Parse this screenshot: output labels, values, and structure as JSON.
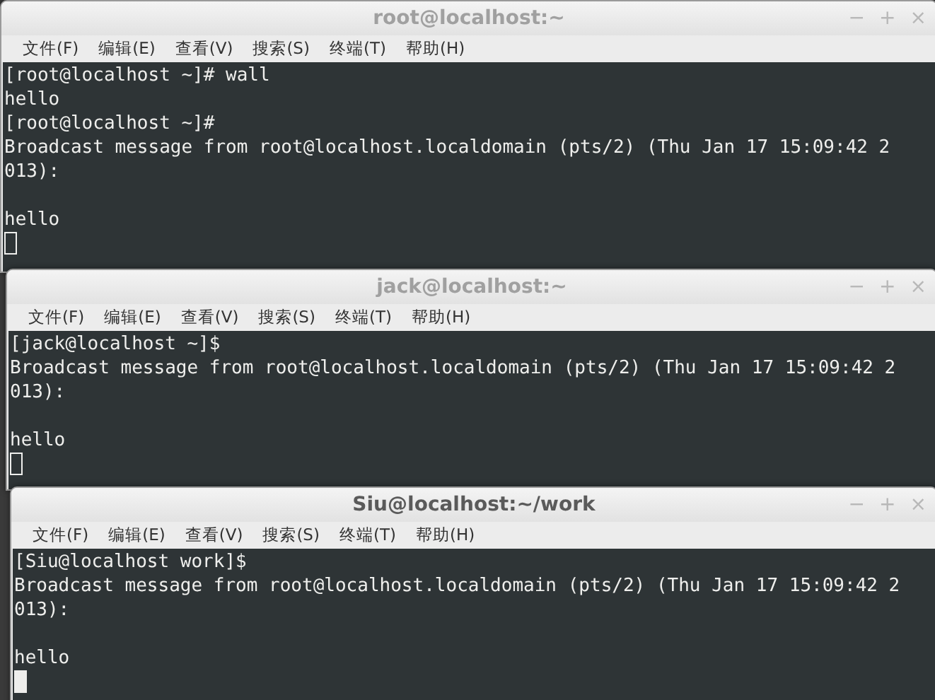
{
  "windows": [
    {
      "title": "root@localhost:~",
      "active": false,
      "controls": [
        "−",
        "+",
        "×"
      ],
      "menu": [
        "文件(F)",
        "编辑(E)",
        "查看(V)",
        "搜索(S)",
        "终端(T)",
        "帮助(H)"
      ],
      "lines": [
        {
          "kind": "text",
          "text": "[root@localhost ~]# wall"
        },
        {
          "kind": "text",
          "text": "hello"
        },
        {
          "kind": "text",
          "text": "[root@localhost ~]#"
        },
        {
          "kind": "text",
          "text": "Broadcast message from root@localhost.localdomain (pts/2) (Thu Jan 17 15:09:42 2"
        },
        {
          "kind": "text",
          "text": "013):"
        },
        {
          "kind": "blank"
        },
        {
          "kind": "text",
          "text": "hello"
        },
        {
          "kind": "cursor"
        }
      ]
    },
    {
      "title": "jack@localhost:~",
      "active": false,
      "controls": [
        "−",
        "+",
        "×"
      ],
      "menu": [
        "文件(F)",
        "编辑(E)",
        "查看(V)",
        "搜索(S)",
        "终端(T)",
        "帮助(H)"
      ],
      "lines": [
        {
          "kind": "text",
          "text": "[jack@localhost ~]$"
        },
        {
          "kind": "text",
          "text": "Broadcast message from root@localhost.localdomain (pts/2) (Thu Jan 17 15:09:42 2"
        },
        {
          "kind": "text",
          "text": "013):"
        },
        {
          "kind": "blank"
        },
        {
          "kind": "text",
          "text": "hello"
        },
        {
          "kind": "cursor"
        }
      ]
    },
    {
      "title": "Siu@localhost:~/work",
      "active": true,
      "controls": [
        "−",
        "+",
        "×"
      ],
      "menu": [
        "文件(F)",
        "编辑(E)",
        "查看(V)",
        "搜索(S)",
        "终端(T)",
        "帮助(H)"
      ],
      "lines": [
        {
          "kind": "text",
          "text": "[Siu@localhost work]$"
        },
        {
          "kind": "text",
          "text": "Broadcast message from root@localhost.localdomain (pts/2) (Thu Jan 17 15:09:42 2"
        },
        {
          "kind": "text",
          "text": "013):"
        },
        {
          "kind": "blank"
        },
        {
          "kind": "text",
          "text": "hello"
        },
        {
          "kind": "cursor"
        }
      ]
    }
  ]
}
